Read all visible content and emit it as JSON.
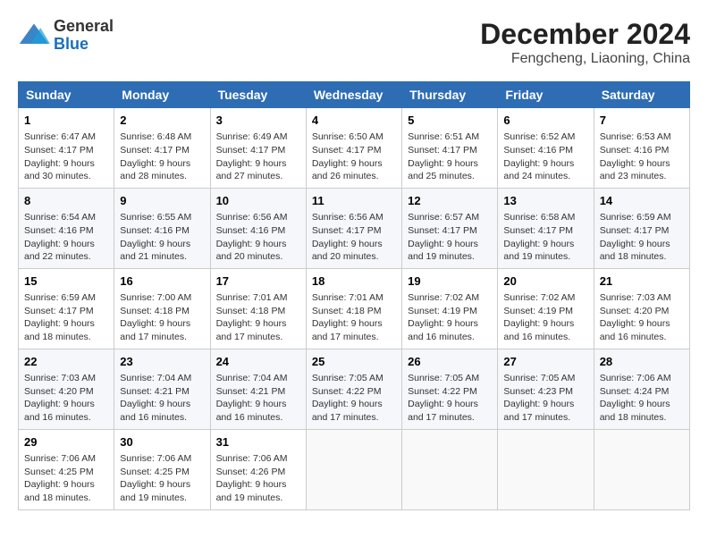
{
  "header": {
    "logo_general": "General",
    "logo_blue": "Blue",
    "month_year": "December 2024",
    "location": "Fengcheng, Liaoning, China"
  },
  "days_of_week": [
    "Sunday",
    "Monday",
    "Tuesday",
    "Wednesday",
    "Thursday",
    "Friday",
    "Saturday"
  ],
  "weeks": [
    [
      {
        "day": "1",
        "sunrise": "6:47 AM",
        "sunset": "4:17 PM",
        "daylight": "9 hours and 30 minutes."
      },
      {
        "day": "2",
        "sunrise": "6:48 AM",
        "sunset": "4:17 PM",
        "daylight": "9 hours and 28 minutes."
      },
      {
        "day": "3",
        "sunrise": "6:49 AM",
        "sunset": "4:17 PM",
        "daylight": "9 hours and 27 minutes."
      },
      {
        "day": "4",
        "sunrise": "6:50 AM",
        "sunset": "4:17 PM",
        "daylight": "9 hours and 26 minutes."
      },
      {
        "day": "5",
        "sunrise": "6:51 AM",
        "sunset": "4:17 PM",
        "daylight": "9 hours and 25 minutes."
      },
      {
        "day": "6",
        "sunrise": "6:52 AM",
        "sunset": "4:16 PM",
        "daylight": "9 hours and 24 minutes."
      },
      {
        "day": "7",
        "sunrise": "6:53 AM",
        "sunset": "4:16 PM",
        "daylight": "9 hours and 23 minutes."
      }
    ],
    [
      {
        "day": "8",
        "sunrise": "6:54 AM",
        "sunset": "4:16 PM",
        "daylight": "9 hours and 22 minutes."
      },
      {
        "day": "9",
        "sunrise": "6:55 AM",
        "sunset": "4:16 PM",
        "daylight": "9 hours and 21 minutes."
      },
      {
        "day": "10",
        "sunrise": "6:56 AM",
        "sunset": "4:16 PM",
        "daylight": "9 hours and 20 minutes."
      },
      {
        "day": "11",
        "sunrise": "6:56 AM",
        "sunset": "4:17 PM",
        "daylight": "9 hours and 20 minutes."
      },
      {
        "day": "12",
        "sunrise": "6:57 AM",
        "sunset": "4:17 PM",
        "daylight": "9 hours and 19 minutes."
      },
      {
        "day": "13",
        "sunrise": "6:58 AM",
        "sunset": "4:17 PM",
        "daylight": "9 hours and 19 minutes."
      },
      {
        "day": "14",
        "sunrise": "6:59 AM",
        "sunset": "4:17 PM",
        "daylight": "9 hours and 18 minutes."
      }
    ],
    [
      {
        "day": "15",
        "sunrise": "6:59 AM",
        "sunset": "4:17 PM",
        "daylight": "9 hours and 18 minutes."
      },
      {
        "day": "16",
        "sunrise": "7:00 AM",
        "sunset": "4:18 PM",
        "daylight": "9 hours and 17 minutes."
      },
      {
        "day": "17",
        "sunrise": "7:01 AM",
        "sunset": "4:18 PM",
        "daylight": "9 hours and 17 minutes."
      },
      {
        "day": "18",
        "sunrise": "7:01 AM",
        "sunset": "4:18 PM",
        "daylight": "9 hours and 17 minutes."
      },
      {
        "day": "19",
        "sunrise": "7:02 AM",
        "sunset": "4:19 PM",
        "daylight": "9 hours and 16 minutes."
      },
      {
        "day": "20",
        "sunrise": "7:02 AM",
        "sunset": "4:19 PM",
        "daylight": "9 hours and 16 minutes."
      },
      {
        "day": "21",
        "sunrise": "7:03 AM",
        "sunset": "4:20 PM",
        "daylight": "9 hours and 16 minutes."
      }
    ],
    [
      {
        "day": "22",
        "sunrise": "7:03 AM",
        "sunset": "4:20 PM",
        "daylight": "9 hours and 16 minutes."
      },
      {
        "day": "23",
        "sunrise": "7:04 AM",
        "sunset": "4:21 PM",
        "daylight": "9 hours and 16 minutes."
      },
      {
        "day": "24",
        "sunrise": "7:04 AM",
        "sunset": "4:21 PM",
        "daylight": "9 hours and 16 minutes."
      },
      {
        "day": "25",
        "sunrise": "7:05 AM",
        "sunset": "4:22 PM",
        "daylight": "9 hours and 17 minutes."
      },
      {
        "day": "26",
        "sunrise": "7:05 AM",
        "sunset": "4:22 PM",
        "daylight": "9 hours and 17 minutes."
      },
      {
        "day": "27",
        "sunrise": "7:05 AM",
        "sunset": "4:23 PM",
        "daylight": "9 hours and 17 minutes."
      },
      {
        "day": "28",
        "sunrise": "7:06 AM",
        "sunset": "4:24 PM",
        "daylight": "9 hours and 18 minutes."
      }
    ],
    [
      {
        "day": "29",
        "sunrise": "7:06 AM",
        "sunset": "4:25 PM",
        "daylight": "9 hours and 18 minutes."
      },
      {
        "day": "30",
        "sunrise": "7:06 AM",
        "sunset": "4:25 PM",
        "daylight": "9 hours and 19 minutes."
      },
      {
        "day": "31",
        "sunrise": "7:06 AM",
        "sunset": "4:26 PM",
        "daylight": "9 hours and 19 minutes."
      },
      null,
      null,
      null,
      null
    ]
  ],
  "labels": {
    "sunrise": "Sunrise:",
    "sunset": "Sunset:",
    "daylight": "Daylight:"
  }
}
